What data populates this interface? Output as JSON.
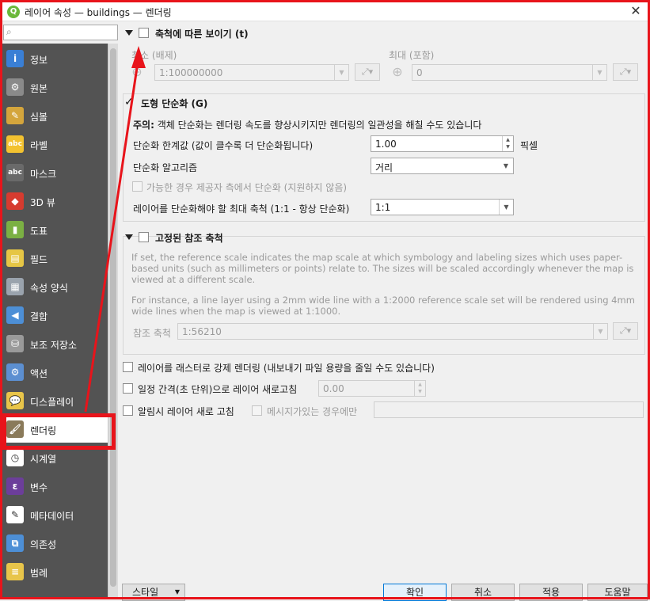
{
  "window": {
    "title": "레이어 속성 — buildings — 렌더링",
    "app_icon": "Q",
    "close_symbol": "✕"
  },
  "search": {
    "value": "",
    "icon": "search-icon",
    "icon_glyph": "⌕"
  },
  "sidebar": {
    "items": [
      {
        "label": "정보",
        "icon": "info-icon",
        "glyph": "i",
        "color": "#3a7fd5"
      },
      {
        "label": "원본",
        "icon": "source-wrench-icon",
        "glyph": "⚙",
        "color": "#8a8a8a"
      },
      {
        "label": "심볼",
        "icon": "symbology-brush-icon",
        "glyph": "✎",
        "color": "#d4a53c"
      },
      {
        "label": "라벨",
        "icon": "labels-abc-icon",
        "glyph": "abc",
        "color": "#f3c230"
      },
      {
        "label": "마스크",
        "icon": "mask-abc-icon",
        "glyph": "abc",
        "color": "#6a6a6a"
      },
      {
        "label": "3D 뷰",
        "icon": "3d-view-cube-icon",
        "glyph": "◆",
        "color": "#d63b2f"
      },
      {
        "label": "도표",
        "icon": "diagrams-icon",
        "glyph": "▮",
        "color": "#7bb043"
      },
      {
        "label": "필드",
        "icon": "fields-table-icon",
        "glyph": "▤",
        "color": "#e6c645"
      },
      {
        "label": "속성 양식",
        "icon": "attributes-form-icon",
        "glyph": "▦",
        "color": "#9aa3ad"
      },
      {
        "label": "결합",
        "icon": "joins-icon",
        "glyph": "◀",
        "color": "#4d8fd6"
      },
      {
        "label": "보조 저장소",
        "icon": "auxiliary-storage-icon",
        "glyph": "⛁",
        "color": "#9a9a9a"
      },
      {
        "label": "액션",
        "icon": "actions-gear-icon",
        "glyph": "⚙",
        "color": "#5c8fd1"
      },
      {
        "label": "디스플레이",
        "icon": "display-tooltip-icon",
        "glyph": "💬",
        "color": "#e8c54a"
      },
      {
        "label": "렌더링",
        "icon": "rendering-paintbrush-icon",
        "glyph": "🖌",
        "color": "#8a7a5a"
      },
      {
        "label": "시계열",
        "icon": "temporal-clock-icon",
        "glyph": "◷",
        "color": "#ffffff"
      },
      {
        "label": "변수",
        "icon": "variables-epsilon-icon",
        "glyph": "ε",
        "color": "#6c3e9a"
      },
      {
        "label": "메타데이터",
        "icon": "metadata-edit-icon",
        "glyph": "✎",
        "color": "#ffffff"
      },
      {
        "label": "의존성",
        "icon": "dependencies-icon",
        "glyph": "⧉",
        "color": "#4d8fd6"
      },
      {
        "label": "범례",
        "icon": "legend-icon",
        "glyph": "≡",
        "color": "#e8c54a"
      }
    ],
    "active_index": 13
  },
  "scale_visibility": {
    "title": "축척에 따른 보이기 (t)",
    "checked": false,
    "min_label": "최소 (배제)",
    "min_value": "1:100000000",
    "max_label": "최대 (포함)",
    "max_value": "0",
    "zoom_icon": "zoom-in-icon",
    "zoom_glyph": "⊕",
    "tool_glyph": "▾"
  },
  "simplification": {
    "title": "도형 단순화 (G)",
    "checked": true,
    "check_glyph": "✓",
    "note_bold": "주의:",
    "note_text": " 객체 단순화는 렌더링 속도를 향상시키지만 렌더링의 일관성을 해칠 수도 있습니다",
    "threshold_label": "단순화 한계값 (값이 클수록 더 단순화됩니다)",
    "threshold_value": "1.00",
    "threshold_unit": "픽셀",
    "algorithm_label": "단순화 알고리즘",
    "algorithm_value": "거리",
    "provider_label": "가능한 경우 제공자 측에서 단순화 (지원하지 않음)",
    "provider_checked": false,
    "max_scale_label": "레이어를 단순화해야 할 최대 축척 (1:1 - 항상 단순화)",
    "max_scale_value": "1:1"
  },
  "reference_scale": {
    "title": "고정된 참조 축척",
    "checked": false,
    "para1": "If set, the reference scale indicates the map scale at which symbology and labeling sizes which uses paper-based units (such as millimeters or points) relate to. The sizes will be scaled accordingly whenever the map is viewed at a different scale.",
    "para2": "For instance, a line layer using a 2mm wide line with a 1:2000 reference scale set will be rendered using 4mm wide lines when the map is viewed at 1:1000.",
    "scale_label": "참조 축척",
    "scale_value": "1:56210"
  },
  "options": {
    "raster_label": "레이어를 래스터로 강제 렌더링 (내보내기 파일 용량을 줄일 수도 있습니다)",
    "refresh_interval_label": "일정 간격(초 단위)으로 레이어 새로고침",
    "refresh_interval_value": "0.00",
    "notify_label": "알림시 레이어 새로 고침",
    "message_only_label": "메시지가있는 경우에만",
    "message_value": ""
  },
  "buttons": {
    "style": "스타일",
    "ok": "확인",
    "cancel": "취소",
    "apply": "적용",
    "help": "도움말"
  },
  "colors": {
    "annotation_red": "#e8141b",
    "sidebar_bg": "#535353"
  }
}
